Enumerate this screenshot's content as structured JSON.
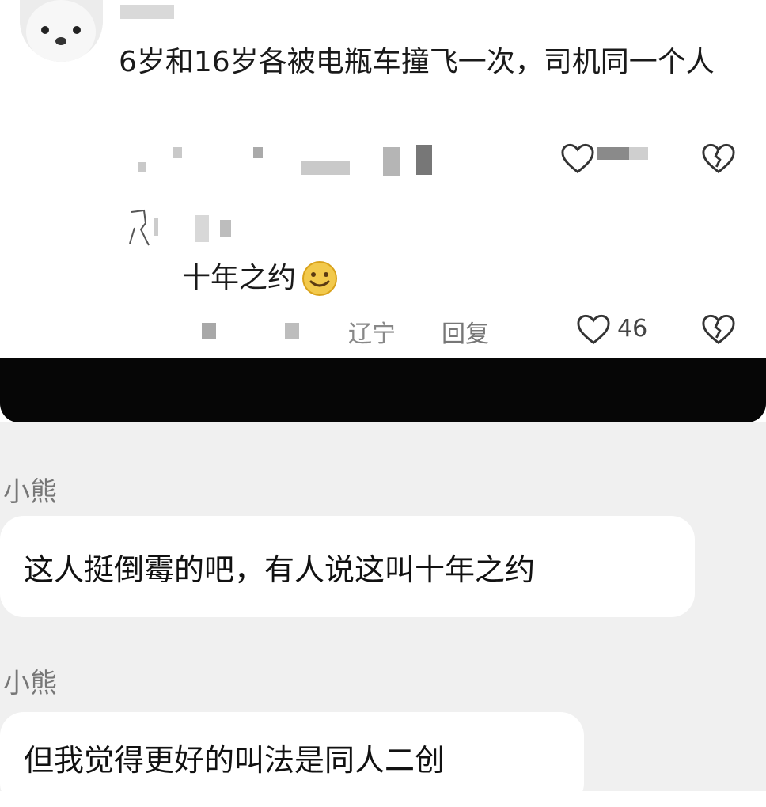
{
  "comment": {
    "text": "6岁和16岁各被电瓶车撞飞一次，司机同一个人"
  },
  "reply": {
    "text": "十年之约",
    "emoji": "smile-emoji",
    "location": "辽宁",
    "reply_label": "回复",
    "likes": "46"
  },
  "chat": {
    "messages": [
      {
        "sender": "小熊",
        "text": "这人挺倒霉的吧，有人说这叫十年之约"
      },
      {
        "sender": "小熊",
        "text": "但我觉得更好的叫法是同人二创"
      }
    ]
  },
  "icons": {
    "like": "heart-outline-icon",
    "dislike": "broken-heart-icon"
  },
  "colors": {
    "separator_bar": "#060606",
    "chat_background": "#f0f0f0",
    "bubble": "#ffffff"
  }
}
